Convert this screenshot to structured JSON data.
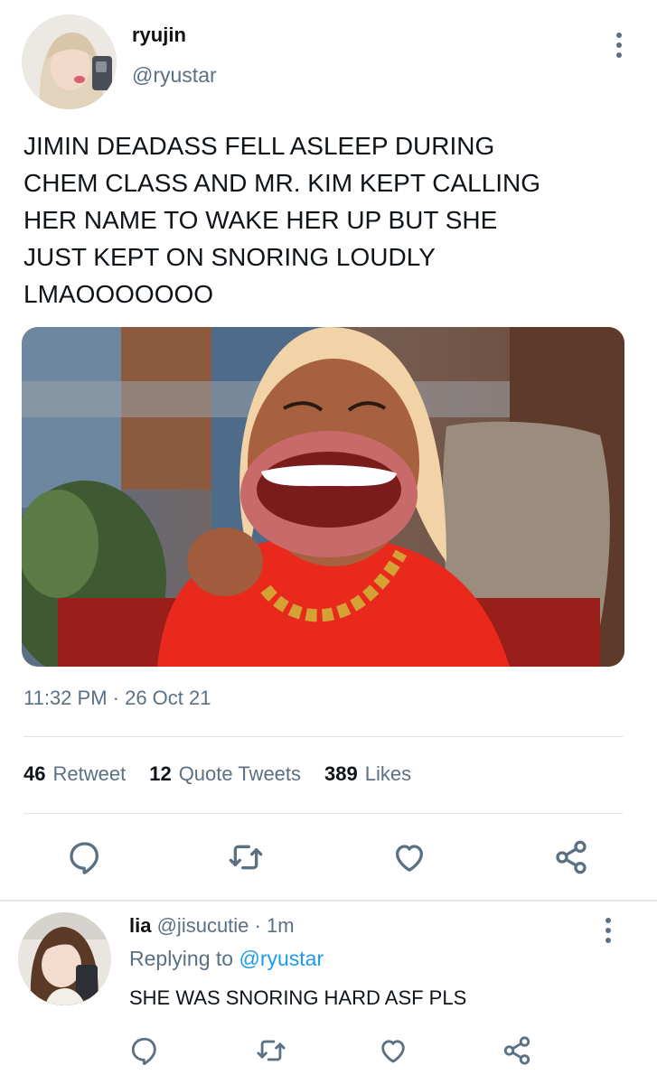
{
  "tweet": {
    "display_name": "ryujin",
    "handle": "@ryustar",
    "text": "JIMIN DEADASS FELL ASLEEP DURING\nCHEM CLASS AND MR. KIM KEPT CALLING\nHER NAME TO WAKE HER UP BUT SHE\nJUST KEPT ON SNORING LOUDLY\nLMAOOOOOOO",
    "timestamp": "11:32 PM · 26 Oct 21",
    "stats": {
      "retweets_count": "46",
      "retweets_label": "Retweet",
      "quotes_count": "12",
      "quotes_label": "Quote Tweets",
      "likes_count": "389",
      "likes_label": "Likes"
    }
  },
  "reply": {
    "display_name": "lia",
    "handle_time": "@jisucutie · 1m",
    "replying_prefix": "Replying to",
    "replying_mention": "@ryustar",
    "text": "SHE WAS SNORING HARD ASF PLS"
  },
  "colors": {
    "secondary_text": "#5b7083",
    "link": "#1d9bf0",
    "divider": "#dde3e8"
  },
  "icons": [
    "more-vertical-icon",
    "reply-icon",
    "retweet-icon",
    "like-icon",
    "share-icon"
  ]
}
